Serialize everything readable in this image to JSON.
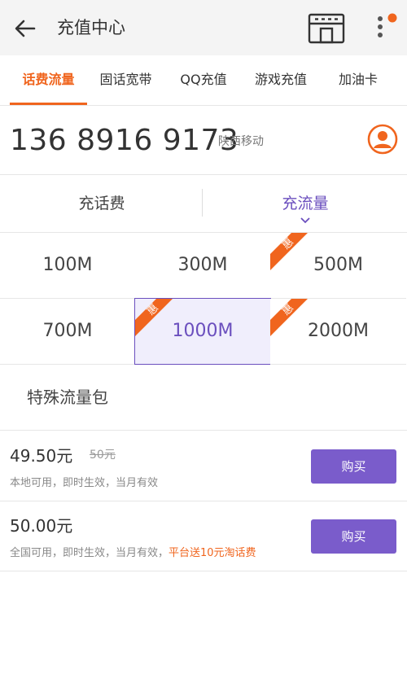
{
  "header": {
    "title": "充值中心",
    "back_icon": "back-arrow-icon",
    "store_icon": "store-icon",
    "more_icon": "more-vert-icon",
    "notify_dot_color": "#f0651e"
  },
  "tabs": [
    {
      "label": "话费流量",
      "active": true
    },
    {
      "label": "固话宽带"
    },
    {
      "label": "QQ充值"
    },
    {
      "label": "游戏充值"
    },
    {
      "label": "加油卡"
    }
  ],
  "phone": {
    "number": "136 8916 9173",
    "carrier": "陕西移动",
    "contact_icon": "person-icon"
  },
  "segments": [
    {
      "label": "充话费"
    },
    {
      "label": "充流量",
      "active": true
    }
  ],
  "packages": [
    {
      "label": "100M"
    },
    {
      "label": "300M"
    },
    {
      "label": "500M",
      "badge": "惠"
    },
    {
      "label": "700M"
    },
    {
      "label": "1000M",
      "badge": "惠",
      "selected": true
    },
    {
      "label": "2000M",
      "badge": "惠"
    },
    {
      "label": "特殊流量包"
    }
  ],
  "offers": [
    {
      "price": "49.50元",
      "old_price": "50元",
      "desc": "本地可用，即时生效，当月有效",
      "promo": "",
      "button": "购买"
    },
    {
      "price": "50.00元",
      "old_price": "",
      "desc": "全国可用，即时生效，当月有效，",
      "promo": "平台送10元淘话费",
      "button": "购买"
    }
  ],
  "colors": {
    "accent": "#f0651e",
    "primary": "#7a5ccb",
    "selected_bg": "#f0eefc"
  }
}
